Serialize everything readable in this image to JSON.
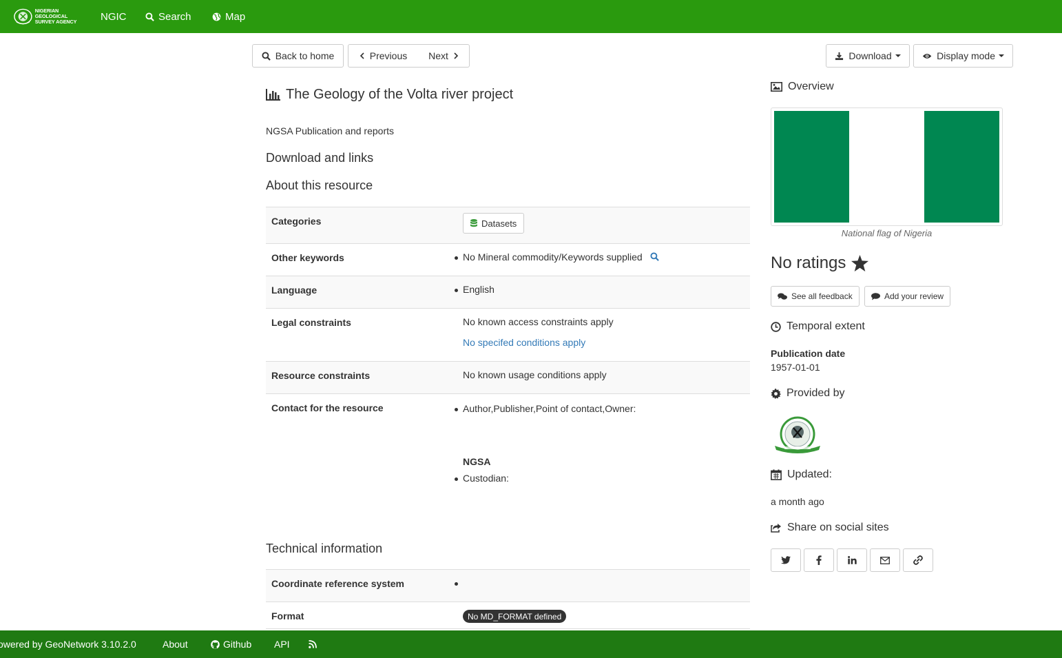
{
  "nav": {
    "logo_text_line1": "NIGERIAN GEOLOGICAL",
    "logo_text_line2": "SURVEY AGENCY",
    "brand": "NGIC",
    "search": "Search",
    "map": "Map",
    "bar_color": "#2a9a0e"
  },
  "toolbar": {
    "back": "Back to home",
    "previous": "Previous",
    "next": "Next",
    "download": "Download",
    "display_mode": "Display mode"
  },
  "record": {
    "title": "The Geology of the Volta river project",
    "subtitle": "NGSA Publication and reports",
    "download_links_heading": "Download and links",
    "about_heading": "About this resource",
    "rows": {
      "categories": {
        "label": "Categories",
        "value": "Datasets"
      },
      "keywords": {
        "label": "Other keywords",
        "value": "No Mineral commodity/Keywords supplied"
      },
      "language": {
        "label": "Language",
        "value": "English"
      },
      "legal": {
        "label": "Legal constraints",
        "value": "No known access constraints apply",
        "link": "No specifed conditions apply"
      },
      "resource": {
        "label": "Resource constraints",
        "value": "No known usage conditions apply"
      },
      "contact": {
        "label": "Contact for the resource",
        "roles": "Author,Publisher,Point of contact,Owner:",
        "org": "NGSA",
        "custodian": "Custodian:"
      }
    },
    "technical_heading": "Technical information",
    "technical": {
      "crs": {
        "label": "Coordinate reference system",
        "value": ""
      },
      "format": {
        "label": "Format",
        "value": "No MD_FORMAT defined"
      }
    }
  },
  "sidebar": {
    "overview": "Overview",
    "overview_caption": "National flag of Nigeria",
    "flag_colors": [
      "#008751",
      "#ffffff",
      "#008751"
    ],
    "ratings": "No ratings",
    "see_feedback": "See all feedback",
    "add_review": "Add your review",
    "temporal": "Temporal extent",
    "publication_label": "Publication date",
    "publication_date": "1957-01-01",
    "provided_by": "Provided by",
    "updated": "Updated:",
    "updated_value": "a month ago",
    "share": "Share on social sites"
  },
  "footer": {
    "powered": "owered by GeoNetwork 3.10.2.0",
    "about": "About",
    "github": "Github",
    "api": "API",
    "bg_color": "#1f7a12"
  }
}
